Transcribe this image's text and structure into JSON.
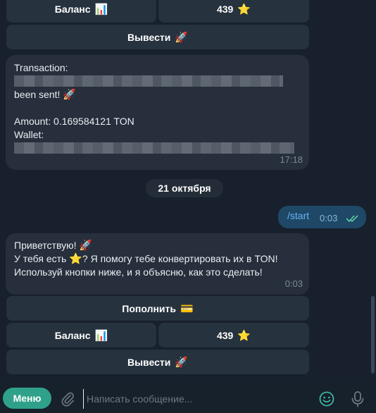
{
  "keyboard_top": {
    "balance_label": "Баланс",
    "balance_emoji": "📊",
    "stars_label": "439",
    "stars_emoji": "⭐",
    "withdraw_label": "Вывести",
    "withdraw_emoji": "🚀"
  },
  "transaction_message": {
    "line1": "Transaction:",
    "line2": "been sent!",
    "line2_emoji": "🚀",
    "amount": "Amount: 0.169584121 TON",
    "wallet_label": "Wallet:",
    "time": "17:18"
  },
  "date_separator": "21 октября",
  "outgoing_message": {
    "text": "/start",
    "time": "0:03"
  },
  "welcome_message": {
    "line1": "Приветствую!",
    "line1_emoji": "🚀",
    "line2_a": "У тебя есть",
    "line2_emoji": "⭐",
    "line2_b": "? Я помогу тебе конвертировать их в TON!",
    "line3": "Используй кнопки ниже, и я объясню, как это сделать!",
    "time": "0:03"
  },
  "keyboard_bottom": {
    "topup_label": "Пополнить",
    "topup_emoji": "💳",
    "balance_label": "Баланс",
    "balance_emoji": "📊",
    "stars_label": "439",
    "stars_emoji": "⭐",
    "withdraw_label": "Вывести",
    "withdraw_emoji": "🚀"
  },
  "input_bar": {
    "menu_label": "Меню",
    "placeholder": "Написать сообщение...",
    "attach_icon": "paperclip-icon",
    "emoji_icon": "smile-icon",
    "mic_icon": "microphone-icon"
  },
  "colors": {
    "chat_background": "#17202c",
    "incoming_bubble": "#262f3b",
    "outgoing_bubble": "#1e4866",
    "keyboard_button": "#26323e",
    "menu_button": "#2fa18a",
    "accent": "#3fb5a0"
  }
}
